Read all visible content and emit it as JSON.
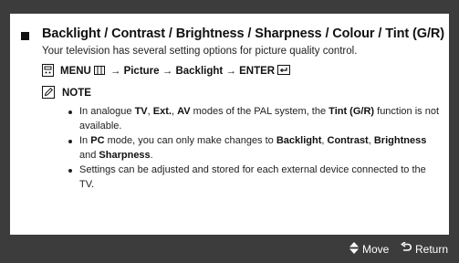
{
  "section": {
    "title": "Backlight / Contrast / Brightness / Sharpness / Colour / Tint (G/R)",
    "description": "Your television has several setting options for picture quality control."
  },
  "menu_path": {
    "text_1": "MENU",
    "text_2": "→ Picture → Backlight → ENTER",
    "icons": [
      "remote-icon",
      "menu-grid-icon",
      "enter-icon"
    ]
  },
  "note": {
    "label": "NOTE",
    "items": [
      {
        "parts": [
          "In analogue ",
          "TV",
          ", ",
          "Ext.",
          ", ",
          "AV",
          " modes of the PAL system, the ",
          "Tint (G/R)",
          " function is not available."
        ]
      },
      {
        "parts": [
          "In ",
          "PC",
          " mode, you can only make changes to ",
          "Backlight",
          ", ",
          "Contrast",
          ", ",
          "Brightness",
          " and ",
          "Sharpness",
          "."
        ]
      },
      {
        "parts": [
          "Settings can be adjusted and stored for each external device connected to the TV."
        ]
      }
    ]
  },
  "footer": {
    "move_label": "Move",
    "return_label": "Return",
    "icons": [
      "up-down-arrow-icon",
      "return-icon"
    ]
  },
  "colors": {
    "frame": "#3c3c3c",
    "panel": "#ffffff",
    "text": "#111111"
  }
}
